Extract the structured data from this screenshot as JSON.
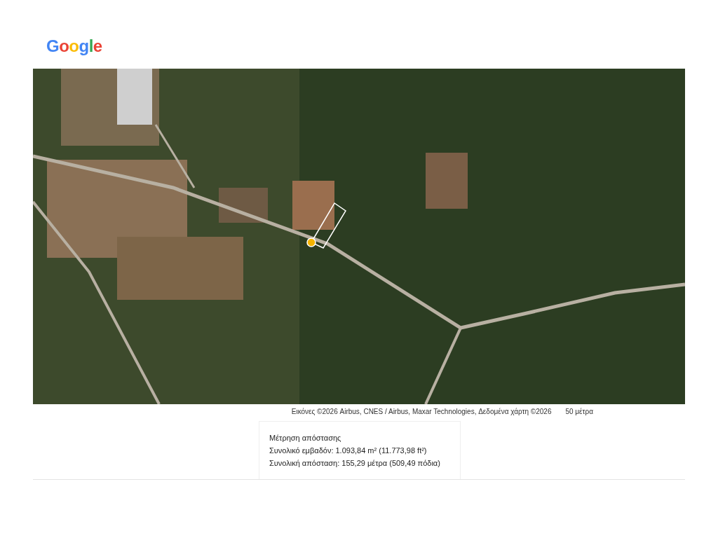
{
  "logo": "Google",
  "map": {
    "attribution": "Εικόνες ©2026 Airbus, CNES / Airbus, Maxar Technologies, Δεδομένα χάρτη ©2026",
    "scale": "50 μέτρα"
  },
  "measurement": {
    "title": "Μέτρηση απόστασης",
    "lines": [
      "Συνολικό εμβαδόν: 1.093,84 m² (11.773,98 ft²)",
      "Συνολική απόσταση: 155,29 μέτρα (509,49 πόδια)"
    ]
  }
}
